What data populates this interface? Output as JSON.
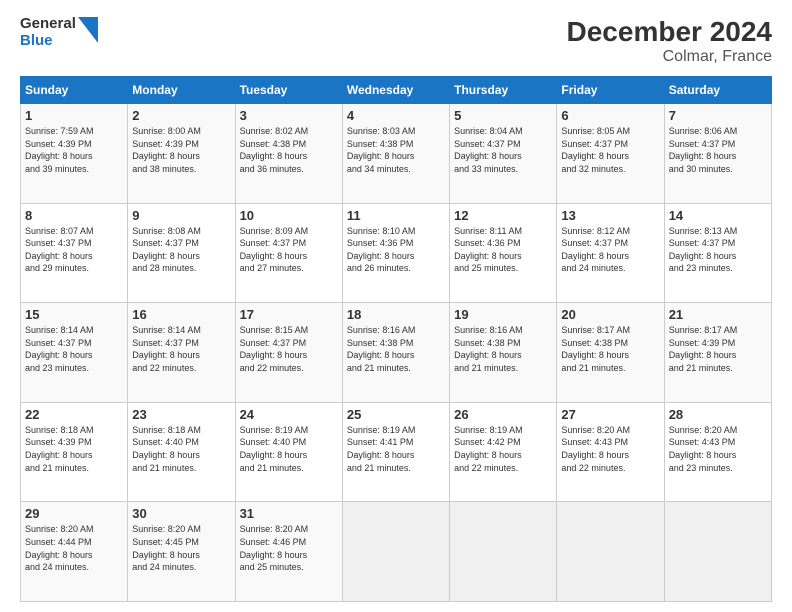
{
  "header": {
    "logo_line1": "General",
    "logo_line2": "Blue",
    "title": "December 2024",
    "subtitle": "Colmar, France"
  },
  "calendar": {
    "days_of_week": [
      "Sunday",
      "Monday",
      "Tuesday",
      "Wednesday",
      "Thursday",
      "Friday",
      "Saturday"
    ],
    "weeks": [
      [
        {
          "day": "",
          "info": ""
        },
        {
          "day": "2",
          "info": "Sunrise: 8:00 AM\nSunset: 4:39 PM\nDaylight: 8 hours\nand 38 minutes."
        },
        {
          "day": "3",
          "info": "Sunrise: 8:02 AM\nSunset: 4:38 PM\nDaylight: 8 hours\nand 36 minutes."
        },
        {
          "day": "4",
          "info": "Sunrise: 8:03 AM\nSunset: 4:38 PM\nDaylight: 8 hours\nand 34 minutes."
        },
        {
          "day": "5",
          "info": "Sunrise: 8:04 AM\nSunset: 4:37 PM\nDaylight: 8 hours\nand 33 minutes."
        },
        {
          "day": "6",
          "info": "Sunrise: 8:05 AM\nSunset: 4:37 PM\nDaylight: 8 hours\nand 32 minutes."
        },
        {
          "day": "7",
          "info": "Sunrise: 8:06 AM\nSunset: 4:37 PM\nDaylight: 8 hours\nand 30 minutes."
        }
      ],
      [
        {
          "day": "1",
          "info": "Sunrise: 7:59 AM\nSunset: 4:39 PM\nDaylight: 8 hours\nand 39 minutes."
        },
        {
          "day": "",
          "info": ""
        },
        {
          "day": "",
          "info": ""
        },
        {
          "day": "",
          "info": ""
        },
        {
          "day": "",
          "info": ""
        },
        {
          "day": "",
          "info": ""
        },
        {
          "day": "",
          "info": ""
        }
      ],
      [
        {
          "day": "8",
          "info": "Sunrise: 8:07 AM\nSunset: 4:37 PM\nDaylight: 8 hours\nand 29 minutes."
        },
        {
          "day": "9",
          "info": "Sunrise: 8:08 AM\nSunset: 4:37 PM\nDaylight: 8 hours\nand 28 minutes."
        },
        {
          "day": "10",
          "info": "Sunrise: 8:09 AM\nSunset: 4:37 PM\nDaylight: 8 hours\nand 27 minutes."
        },
        {
          "day": "11",
          "info": "Sunrise: 8:10 AM\nSunset: 4:36 PM\nDaylight: 8 hours\nand 26 minutes."
        },
        {
          "day": "12",
          "info": "Sunrise: 8:11 AM\nSunset: 4:36 PM\nDaylight: 8 hours\nand 25 minutes."
        },
        {
          "day": "13",
          "info": "Sunrise: 8:12 AM\nSunset: 4:37 PM\nDaylight: 8 hours\nand 24 minutes."
        },
        {
          "day": "14",
          "info": "Sunrise: 8:13 AM\nSunset: 4:37 PM\nDaylight: 8 hours\nand 23 minutes."
        }
      ],
      [
        {
          "day": "15",
          "info": "Sunrise: 8:14 AM\nSunset: 4:37 PM\nDaylight: 8 hours\nand 23 minutes."
        },
        {
          "day": "16",
          "info": "Sunrise: 8:14 AM\nSunset: 4:37 PM\nDaylight: 8 hours\nand 22 minutes."
        },
        {
          "day": "17",
          "info": "Sunrise: 8:15 AM\nSunset: 4:37 PM\nDaylight: 8 hours\nand 22 minutes."
        },
        {
          "day": "18",
          "info": "Sunrise: 8:16 AM\nSunset: 4:38 PM\nDaylight: 8 hours\nand 21 minutes."
        },
        {
          "day": "19",
          "info": "Sunrise: 8:16 AM\nSunset: 4:38 PM\nDaylight: 8 hours\nand 21 minutes."
        },
        {
          "day": "20",
          "info": "Sunrise: 8:17 AM\nSunset: 4:38 PM\nDaylight: 8 hours\nand 21 minutes."
        },
        {
          "day": "21",
          "info": "Sunrise: 8:17 AM\nSunset: 4:39 PM\nDaylight: 8 hours\nand 21 minutes."
        }
      ],
      [
        {
          "day": "22",
          "info": "Sunrise: 8:18 AM\nSunset: 4:39 PM\nDaylight: 8 hours\nand 21 minutes."
        },
        {
          "day": "23",
          "info": "Sunrise: 8:18 AM\nSunset: 4:40 PM\nDaylight: 8 hours\nand 21 minutes."
        },
        {
          "day": "24",
          "info": "Sunrise: 8:19 AM\nSunset: 4:40 PM\nDaylight: 8 hours\nand 21 minutes."
        },
        {
          "day": "25",
          "info": "Sunrise: 8:19 AM\nSunset: 4:41 PM\nDaylight: 8 hours\nand 21 minutes."
        },
        {
          "day": "26",
          "info": "Sunrise: 8:19 AM\nSunset: 4:42 PM\nDaylight: 8 hours\nand 22 minutes."
        },
        {
          "day": "27",
          "info": "Sunrise: 8:20 AM\nSunset: 4:43 PM\nDaylight: 8 hours\nand 22 minutes."
        },
        {
          "day": "28",
          "info": "Sunrise: 8:20 AM\nSunset: 4:43 PM\nDaylight: 8 hours\nand 23 minutes."
        }
      ],
      [
        {
          "day": "29",
          "info": "Sunrise: 8:20 AM\nSunset: 4:44 PM\nDaylight: 8 hours\nand 24 minutes."
        },
        {
          "day": "30",
          "info": "Sunrise: 8:20 AM\nSunset: 4:45 PM\nDaylight: 8 hours\nand 24 minutes."
        },
        {
          "day": "31",
          "info": "Sunrise: 8:20 AM\nSunset: 4:46 PM\nDaylight: 8 hours\nand 25 minutes."
        },
        {
          "day": "",
          "info": ""
        },
        {
          "day": "",
          "info": ""
        },
        {
          "day": "",
          "info": ""
        },
        {
          "day": "",
          "info": ""
        }
      ]
    ]
  }
}
